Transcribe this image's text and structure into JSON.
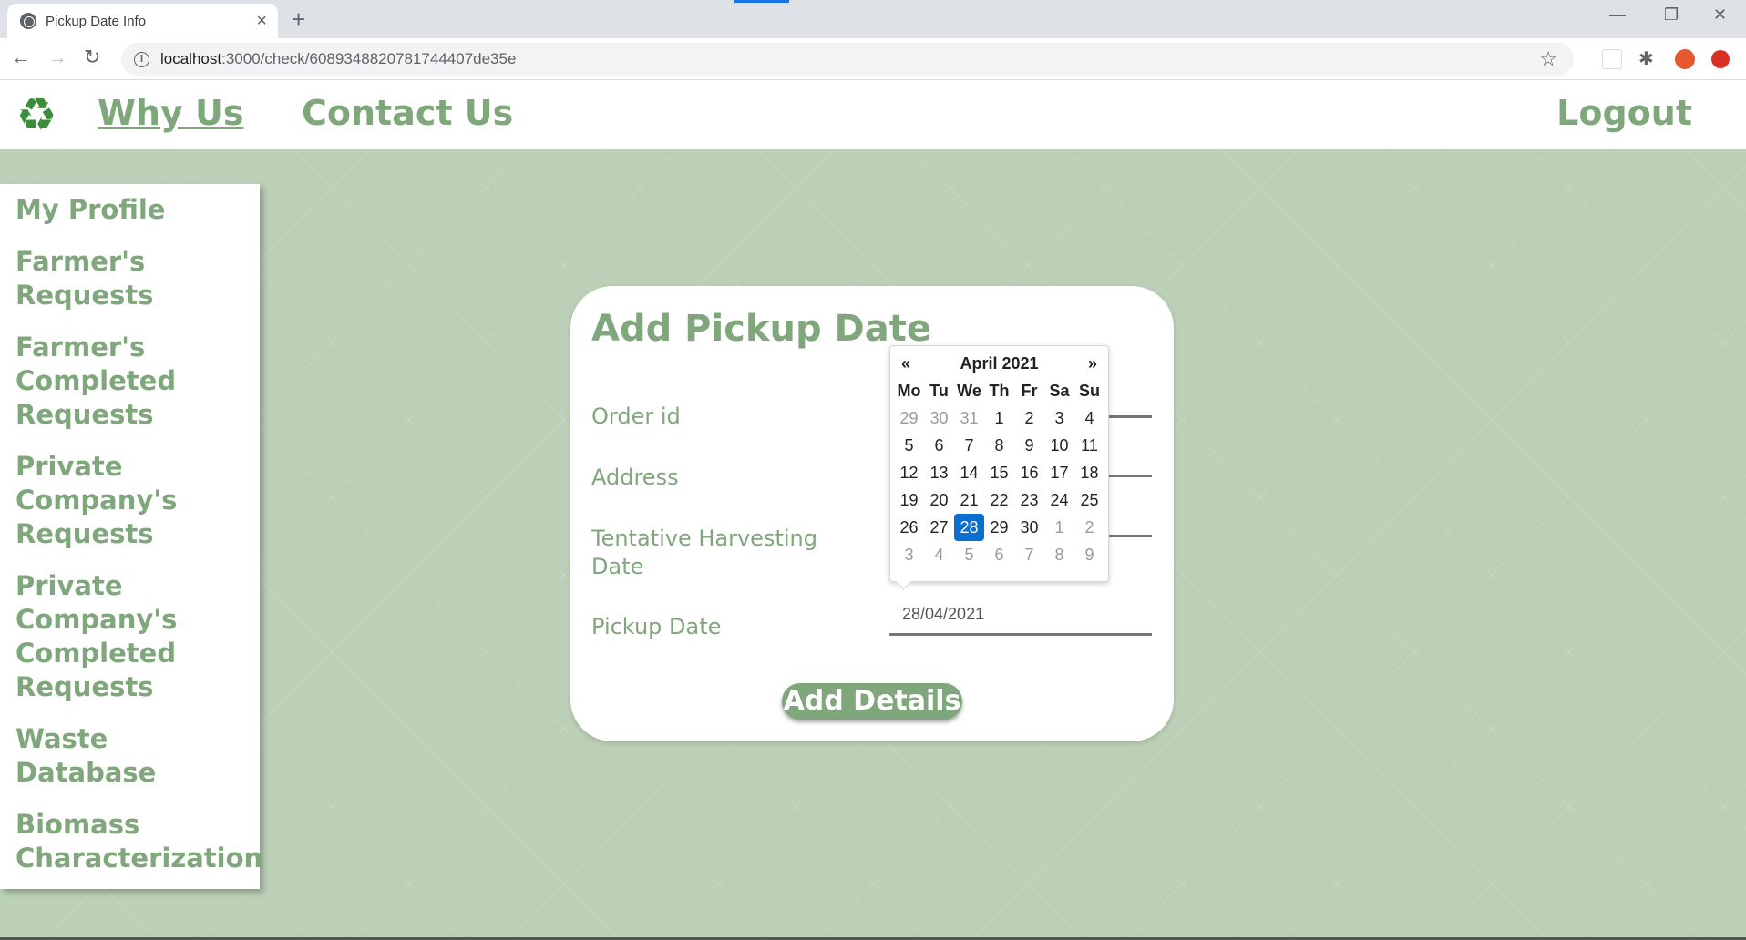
{
  "browser": {
    "tab_title": "Pickup Date Info",
    "url_host": "localhost",
    "url_path": ":3000/check/6089348820781744407de35e"
  },
  "header": {
    "nav_why": "Why Us",
    "nav_contact": "Contact Us",
    "nav_logout": "Logout"
  },
  "sidebar": {
    "items": [
      {
        "label": "My Profile"
      },
      {
        "label": "Farmer's Requests"
      },
      {
        "label": "Farmer's Completed Requests"
      },
      {
        "label": "Private Company's Requests"
      },
      {
        "label": "Private Company's Completed Requests"
      },
      {
        "label": "Waste Database"
      },
      {
        "label": "Biomass Characterization"
      }
    ]
  },
  "form": {
    "title": "Add Pickup Date",
    "order_label": "Order id",
    "address_label": "Address",
    "address_placeholder": "Address",
    "harvest_label": "Tentative Harvesting Date",
    "pickup_label": "Pickup Date",
    "pickup_value": "28/04/2021",
    "submit_label": "Add Details"
  },
  "datepicker": {
    "prev": "«",
    "next": "»",
    "month_label": "April 2021",
    "weekdays": [
      "Mo",
      "Tu",
      "We",
      "Th",
      "Fr",
      "Sa",
      "Su"
    ],
    "weeks": [
      [
        "29",
        "30",
        "31",
        "1",
        "2",
        "3",
        "4"
      ],
      [
        "5",
        "6",
        "7",
        "8",
        "9",
        "10",
        "11"
      ],
      [
        "12",
        "13",
        "14",
        "15",
        "16",
        "17",
        "18"
      ],
      [
        "19",
        "20",
        "21",
        "22",
        "23",
        "24",
        "25"
      ],
      [
        "26",
        "27",
        "28",
        "29",
        "30",
        "1",
        "2"
      ],
      [
        "3",
        "4",
        "5",
        "6",
        "7",
        "8",
        "9"
      ]
    ],
    "selected": "28"
  },
  "colors": {
    "accent": "#7fa77b",
    "background": "#bcd0b7",
    "selected_day": "#0a6fd0"
  }
}
